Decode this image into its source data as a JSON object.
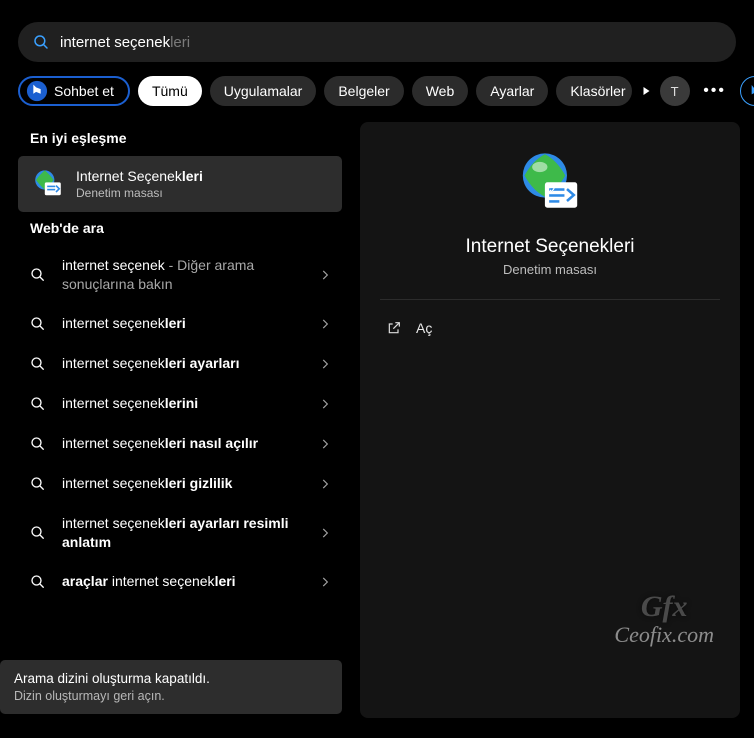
{
  "search": {
    "typed": "internet seçenek",
    "suggestion": "leri"
  },
  "tabs": {
    "chat": "Sohbet et",
    "all": "Tümü",
    "apps": "Uygulamalar",
    "docs": "Belgeler",
    "web": "Web",
    "settings": "Ayarlar",
    "folders": "Klasörler"
  },
  "header_right": {
    "avatar_letter": "T"
  },
  "sections": {
    "best": "En iyi eşleşme",
    "web_search": "Web'de ara"
  },
  "best_match": {
    "title_normal": "Internet Seçenek",
    "title_bold_fragment": "leri",
    "subtitle": "Denetim masası"
  },
  "web_results": [
    {
      "pre": "",
      "main": "internet seçenek",
      "bold": "",
      "post_muted": " - Diğer arama sonuçlarına bakın"
    },
    {
      "pre": "",
      "main": "internet seçenek",
      "bold": "leri",
      "post_muted": ""
    },
    {
      "pre": "",
      "main": "internet seçenek",
      "bold": "leri ayarları",
      "post_muted": ""
    },
    {
      "pre": "",
      "main": "internet seçenek",
      "bold": "lerini",
      "post_muted": ""
    },
    {
      "pre": "",
      "main": "internet seçenek",
      "bold": "leri nasıl açılır",
      "post_muted": ""
    },
    {
      "pre": "",
      "main": "internet seçenek",
      "bold": "leri gizlilik",
      "post_muted": ""
    },
    {
      "pre": "",
      "main": "internet seçenek",
      "bold": "leri ayarları resimli anlatım",
      "post_muted": ""
    },
    {
      "pre_bold": "araçlar",
      "main": " internet seçenek",
      "bold": "leri",
      "post_muted": ""
    }
  ],
  "notice": {
    "title": "Arama dizini oluşturma kapatıldı.",
    "sub": "Dizin oluşturmayı geri açın."
  },
  "preview": {
    "title": "Internet Seçenekleri",
    "subtitle": "Denetim masası",
    "open_label": "Aç"
  },
  "watermark": {
    "top": "Gfx",
    "bottom": "Ceofix.com"
  }
}
